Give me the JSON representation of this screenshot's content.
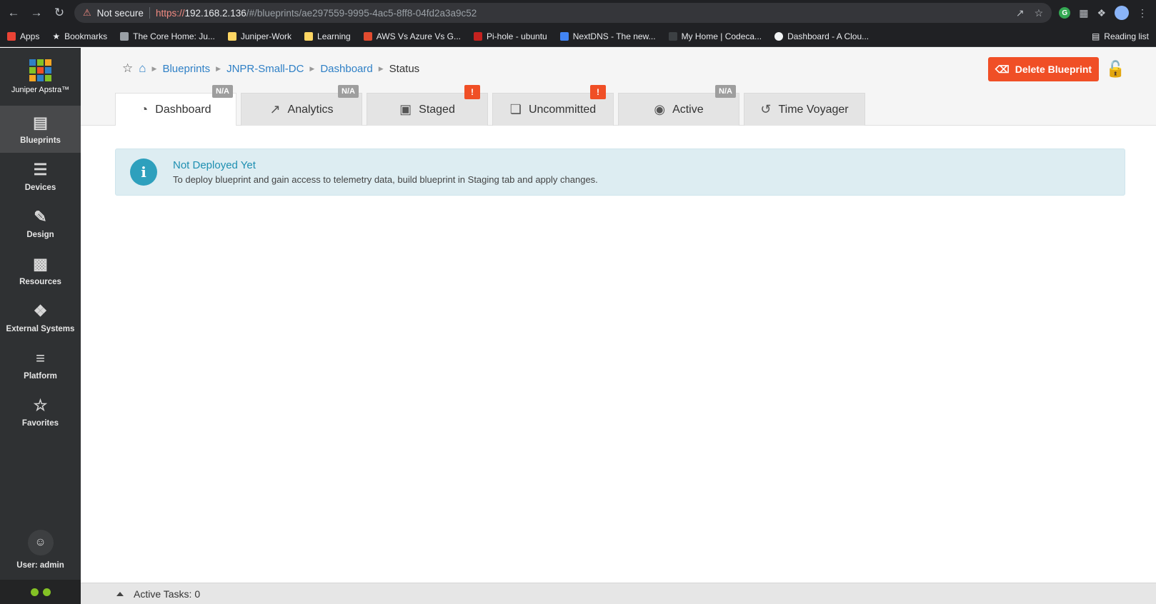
{
  "browser": {
    "not_secure": "Not secure",
    "url_scheme": "https://",
    "url_host": "192.168.2.136",
    "url_path": "/#/blueprints/ae297559-9995-4ac5-8ff8-04fd2a3a9c52",
    "bookmarks": [
      {
        "label": "Apps",
        "color": "#ea4335"
      },
      {
        "label": "Bookmarks",
        "color": "#e8eaed"
      },
      {
        "label": "The Core Home: Ju...",
        "color": "#9aa0a6"
      },
      {
        "label": "Juniper-Work",
        "color": "#fdd663"
      },
      {
        "label": "Learning",
        "color": "#fdd663"
      },
      {
        "label": "AWS Vs Azure Vs G...",
        "color": "#e24b2f"
      },
      {
        "label": "Pi-hole - ubuntu",
        "color": "#c5221f"
      },
      {
        "label": "NextDNS - The new...",
        "color": "#4285f4"
      },
      {
        "label": "My Home | Codeca...",
        "color": "#3c4043"
      },
      {
        "label": "Dashboard - A Clou...",
        "color": "#f1f3f4"
      }
    ],
    "reading_list": "Reading list"
  },
  "sidebar": {
    "logo_text": "Juniper Apstra™",
    "items": [
      {
        "label": "Blueprints",
        "icon": "blueprints-icon"
      },
      {
        "label": "Devices",
        "icon": "devices-icon"
      },
      {
        "label": "Design",
        "icon": "design-icon"
      },
      {
        "label": "Resources",
        "icon": "resources-icon"
      },
      {
        "label": "External Systems",
        "icon": "external-systems-icon"
      },
      {
        "label": "Platform",
        "icon": "platform-icon"
      },
      {
        "label": "Favorites",
        "icon": "favorites-icon"
      }
    ],
    "user": "User: admin"
  },
  "breadcrumb": {
    "items": [
      "Blueprints",
      "JNPR-Small-DC",
      "Dashboard"
    ],
    "current": "Status"
  },
  "header": {
    "delete_label": "Delete Blueprint"
  },
  "tabs": [
    {
      "label": "Dashboard",
      "badge": "N/A"
    },
    {
      "label": "Analytics",
      "badge": "N/A"
    },
    {
      "label": "Staged",
      "badge": "!"
    },
    {
      "label": "Uncommitted",
      "badge": "!"
    },
    {
      "label": "Active",
      "badge": "N/A"
    },
    {
      "label": "Time Voyager",
      "badge": ""
    }
  ],
  "alert": {
    "title": "Not Deployed Yet",
    "message": "To deploy blueprint and gain access to telemetry data, build blueprint in Staging tab and apply changes."
  },
  "taskbar": {
    "label": "Active Tasks: 0"
  },
  "colors": {
    "accent": "#2f80c6",
    "danger": "#f04f26",
    "info": "#2ea0bd",
    "status_ok": "#84c225"
  }
}
